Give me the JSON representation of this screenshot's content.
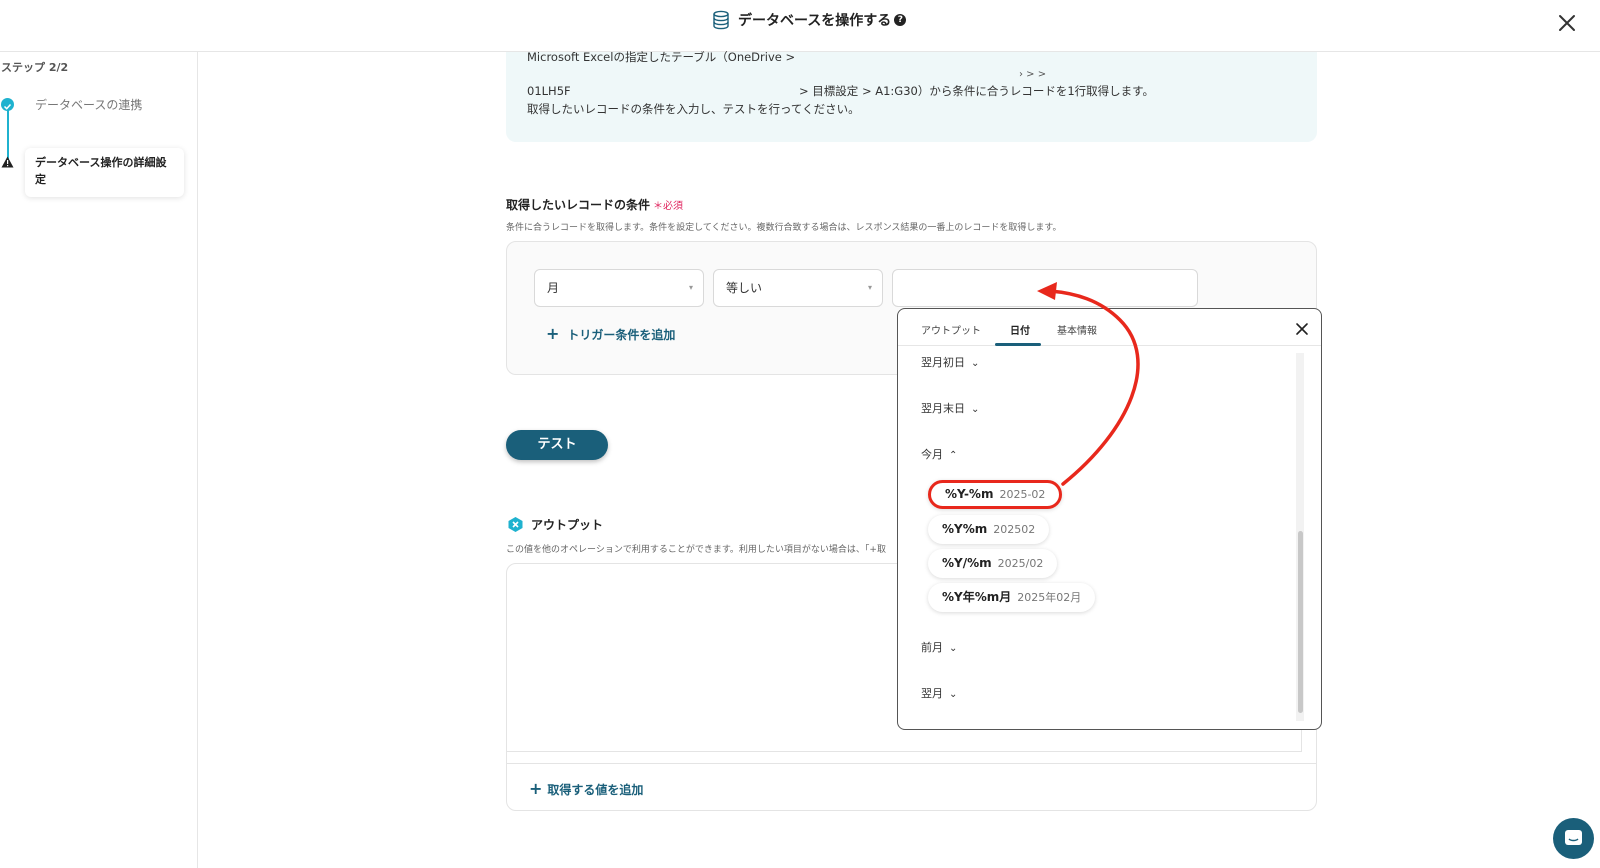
{
  "header": {
    "title": "データベースを操作する",
    "help_glyph": "?"
  },
  "sidebar": {
    "step_count": "ステップ 2/2",
    "steps": [
      {
        "label": "データベースの連携",
        "status": "done"
      },
      {
        "label": "データベース操作の詳細設定",
        "status": "warning"
      }
    ]
  },
  "info": {
    "line1": "Microsoft Excelの指定したテーブル（OneDrive >",
    "line2_arrows": "› > >",
    "line3_prefix": "01LH5F",
    "line3_suffix": "> 目標設定 > A1:G30）から条件に合うレコードを1行取得します。",
    "line4": "取得したいレコードの条件を入力し、テストを行ってください。"
  },
  "conditions": {
    "title": "取得したいレコードの条件",
    "required_mark": "＊必須",
    "description": "条件に合うレコードを取得します。条件を設定してください。複数行合致する場合は、レスポンス結果の一番上のレコードを取得します。",
    "field": "月",
    "operator": "等しい",
    "value": "",
    "add_trigger": "トリガー条件を追加"
  },
  "test_button": "テスト",
  "output": {
    "title": "アウトプット",
    "description": "この値を他のオペレーションで利用することができます。利用したい項目がない場合は、「+取",
    "add_value": "取得する値を追加"
  },
  "popup": {
    "tabs": [
      "アウトプット",
      "日付",
      "基本情報"
    ],
    "active_tab": "日付",
    "groups": {
      "next_month_first": "翌月初日",
      "next_month_last": "翌月末日",
      "this_month": "今月",
      "prev_month": "前月",
      "next_month": "翌月"
    },
    "this_month_items": [
      {
        "format": "%Y-%m",
        "example": "2025-02",
        "highlighted": true
      },
      {
        "format": "%Y%m",
        "example": "202502",
        "highlighted": false
      },
      {
        "format": "%Y/%m",
        "example": "2025/02",
        "highlighted": false
      },
      {
        "format": "%Y年%m月",
        "example": "2025年02月",
        "highlighted": false
      }
    ]
  },
  "colors": {
    "accent": "#1a5f7a",
    "highlight": "#e8281c",
    "step_done": "#1fb2cf",
    "info_bg": "#eff8f9"
  }
}
